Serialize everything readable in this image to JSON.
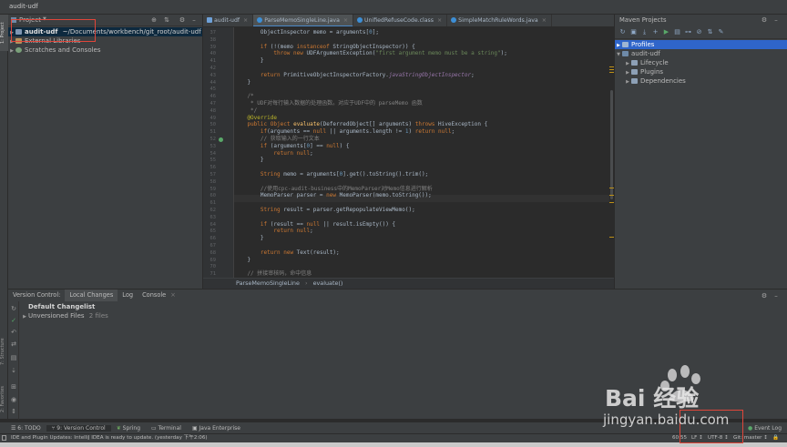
{
  "window": {
    "title": "audit-udf"
  },
  "side_labels": {
    "project": "1: Project",
    "structure": "7: Structure",
    "favorites": "2: Favorites"
  },
  "project": {
    "header": "Project",
    "items": [
      {
        "name": "audit-udf",
        "path": "~/Documents/workbench/git_root/audit-udf"
      },
      {
        "name": "External Libraries"
      },
      {
        "name": "Scratches and Consoles"
      }
    ]
  },
  "tabs": [
    {
      "label": "audit-udf"
    },
    {
      "label": "ParseMemoSingleLine.java"
    },
    {
      "label": "UnifiedRefuseCode.class"
    },
    {
      "label": "SimpleMatchRuleWords.java"
    }
  ],
  "editor": {
    "line_numbers": [
      "37",
      "38",
      "39",
      "40",
      "41",
      "42",
      "43",
      "44",
      "45",
      "46",
      "47",
      "48",
      "49",
      "50",
      "51",
      "52",
      "53",
      "54",
      "55",
      "56",
      "57",
      "58",
      "59",
      "60",
      "61",
      "62",
      "63",
      "64",
      "65",
      "66",
      "67",
      "68",
      "69",
      "70",
      "71"
    ],
    "lines": [
      "        ObjectInspector memo = arguments[0];",
      "",
      "        if (!(memo instanceof StringObjectInspector)) {",
      "            throw new UDFArgumentException(\"first argument memo must be a string\");",
      "        }",
      "",
      "        return PrimitiveObjectInspectorFactory.javaStringObjectInspector;",
      "    }",
      "",
      "    /*",
      "     * UDF对每行输入数据的处理函数。对应于UDF中的 parseMemo 函数",
      "     */",
      "    @Override",
      "    public Object evaluate(DeferredObject[] arguments) throws HiveException {",
      "        if(arguments == null || arguments.length != 1) return null;",
      "        // 获取输入的一行文本",
      "        if (arguments[0] == null) {",
      "            return null;",
      "        }",
      "",
      "        String memo = arguments[0].get().toString().trim();",
      "",
      "        //使用cpc-audit-business中的MemoParser对Memo信息进行解析",
      "        MemoParser parser = new MemoParser(memo.toString());",
      "",
      "        String result = parser.getRepopulateViewMemo();",
      "",
      "        if (result == null || result.isEmpty()) {",
      "            return null;",
      "        }",
      "",
      "        return new Text(result);",
      "    }",
      "",
      "    // 拼接审核码，命中信息"
    ],
    "breadcrumb": {
      "class_name": "ParseMemoSingleLine",
      "separator": "›",
      "method_name": "evaluate()"
    }
  },
  "maven": {
    "title": "Maven Projects",
    "items": [
      {
        "label": "Profiles",
        "selected": true
      },
      {
        "label": "audit-udf"
      },
      {
        "label": "Lifecycle"
      },
      {
        "label": "Plugins"
      },
      {
        "label": "Dependencies"
      }
    ]
  },
  "version_control": {
    "tabs": [
      {
        "label": "Version Control:"
      },
      {
        "label": "Local Changes",
        "active": true
      },
      {
        "label": "Log"
      },
      {
        "label": "Console"
      }
    ],
    "changelist": "Default Changelist",
    "unversioned": "Unversioned Files",
    "unversioned_count": "2 files"
  },
  "bottom_tools": [
    {
      "label": "6: TODO"
    },
    {
      "label": "9: Version Control",
      "active": true
    },
    {
      "label": "Spring"
    },
    {
      "label": "Terminal"
    },
    {
      "label": "Java Enterprise"
    }
  ],
  "event_log": "Event Log",
  "status": {
    "message": "IDE and Plugin Updates: IntelliJ IDEA is ready to update. (yesterday 下午2:06)",
    "position": "60:55",
    "line_sep": "LF ↕",
    "encoding": "UTF-8 ↕",
    "git": "Git: master ↕"
  },
  "watermark": {
    "text": "Bai 经验",
    "url": "jingyan.baidu.com"
  },
  "colors": {
    "accent": "#4a88c7",
    "selection": "#2f65ca",
    "highlight_box": "#e0463a"
  }
}
